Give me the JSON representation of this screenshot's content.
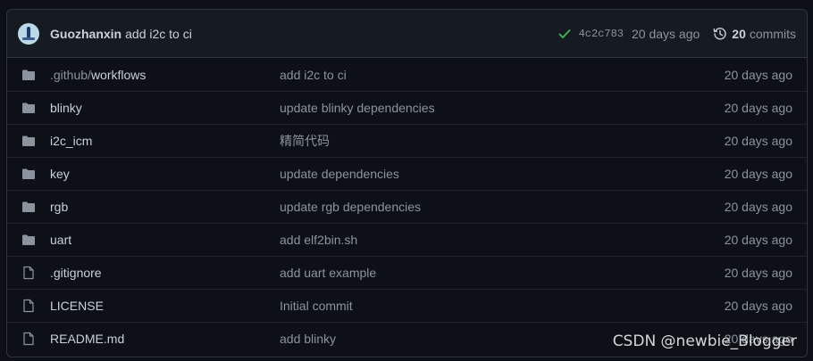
{
  "commit": {
    "author": "Guozhanxin",
    "message": "add i2c to ci",
    "sha": "4c2c783",
    "age": "20 days ago",
    "count": "20",
    "count_label": "commits"
  },
  "files": [
    {
      "type": "folder",
      "name_dim": ".github/",
      "name": "workflows",
      "message": "add i2c to ci",
      "age": "20 days ago"
    },
    {
      "type": "folder",
      "name_dim": "",
      "name": "blinky",
      "message": "update blinky dependencies",
      "age": "20 days ago"
    },
    {
      "type": "folder",
      "name_dim": "",
      "name": "i2c_icm",
      "message": "精简代码",
      "age": "20 days ago"
    },
    {
      "type": "folder",
      "name_dim": "",
      "name": "key",
      "message": "update dependencies",
      "age": "20 days ago"
    },
    {
      "type": "folder",
      "name_dim": "",
      "name": "rgb",
      "message": "update rgb dependencies",
      "age": "20 days ago"
    },
    {
      "type": "folder",
      "name_dim": "",
      "name": "uart",
      "message": "add elf2bin.sh",
      "age": "20 days ago"
    },
    {
      "type": "file",
      "name_dim": "",
      "name": ".gitignore",
      "message": "add uart example",
      "age": "20 days ago"
    },
    {
      "type": "file",
      "name_dim": "",
      "name": "LICENSE",
      "message": "Initial commit",
      "age": "20 days ago"
    },
    {
      "type": "file",
      "name_dim": "",
      "name": "README.md",
      "message": "add blinky",
      "age": "20 days ago"
    }
  ],
  "watermark": "CSDN @newbie_Blogger",
  "colors": {
    "background": "#0d1117",
    "header": "#161b22",
    "border": "#30363d",
    "text": "#c9d1d9",
    "muted": "#8b949e",
    "success": "#3fb950"
  },
  "icons": {
    "check": "check-icon",
    "history": "history-icon",
    "folder": "folder-icon",
    "file": "file-icon"
  }
}
